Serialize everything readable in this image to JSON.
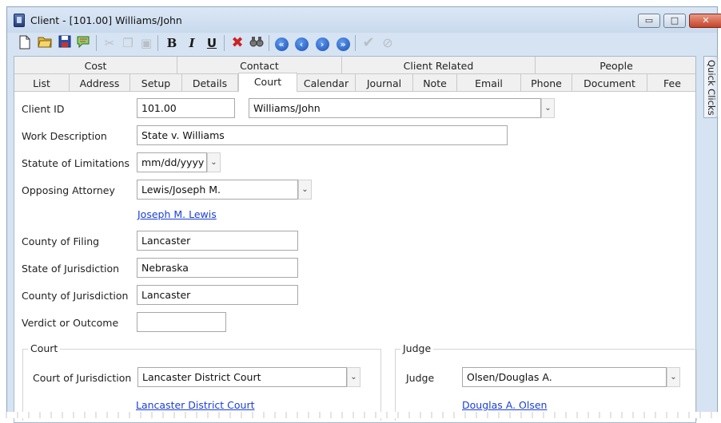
{
  "window": {
    "title": "Client - [101.00] Williams/John",
    "min_glyph": "▭",
    "max_glyph": "□",
    "close_glyph": "✕"
  },
  "toolbar": {
    "icons": [
      "new-document-icon",
      "open-folder-icon",
      "save-icon",
      "comment-icon",
      "cut-icon",
      "copy-icon",
      "paste-icon",
      "bold-icon",
      "italic-icon",
      "underline-icon",
      "delete-icon",
      "binoculars-icon",
      "first-record-icon",
      "previous-record-icon",
      "next-record-icon",
      "last-record-icon",
      "check-icon",
      "cancel-icon"
    ],
    "bold": "B",
    "italic": "I",
    "underline": "U",
    "first": "«",
    "prev": "‹",
    "next": "›",
    "last": "»"
  },
  "tabs": {
    "top": [
      "Cost",
      "Contact",
      "Client Related",
      "People"
    ],
    "bottom": [
      "List",
      "Address",
      "Setup",
      "Details",
      "Court",
      "Calendar",
      "Journal",
      "Note",
      "Email",
      "Phone",
      "Document",
      "Fee"
    ],
    "active": "Court"
  },
  "form": {
    "client_id_label": "Client ID",
    "client_id_value": "101.00",
    "client_name_value": "Williams/John",
    "work_description_label": "Work Description",
    "work_description_value": "State v. Williams",
    "statute_label": "Statute of Limitations",
    "statute_value": "mm/dd/yyyy",
    "opposing_attorney_label": "Opposing Attorney",
    "opposing_attorney_value": "Lewis/Joseph M.",
    "opposing_attorney_link": "Joseph M. Lewis",
    "county_filing_label": "County of Filing",
    "county_filing_value": "Lancaster",
    "state_jurisdiction_label": "State of Jurisdiction",
    "state_jurisdiction_value": "Nebraska",
    "county_jurisdiction_label": "County of Jurisdiction",
    "county_jurisdiction_value": "Lancaster",
    "verdict_label": "Verdict or Outcome",
    "verdict_value": ""
  },
  "court_group": {
    "title": "Court",
    "court_label": "Court of Jurisdiction",
    "court_value": "Lancaster District Court",
    "court_link": "Lancaster District Court"
  },
  "judge_group": {
    "title": "Judge",
    "judge_label": "Judge",
    "judge_value": "Olsen/Douglas A.",
    "judge_link": "Douglas A. Olsen"
  },
  "quick_clicks": {
    "label": "Quick Clicks"
  },
  "dropdown_glyph": "⌄"
}
